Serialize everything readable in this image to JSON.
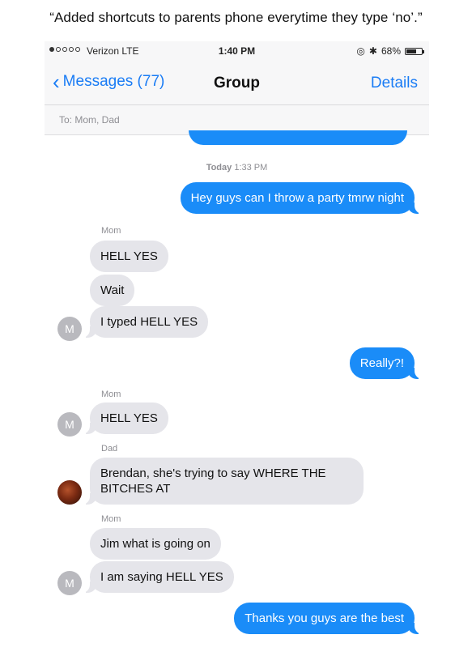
{
  "caption": "“Added shortcuts to parents phone everytime they type ‘no’.”",
  "status_bar": {
    "signal_icon": "signal-dots-icon",
    "carrier": "Verizon  LTE",
    "time": "1:40 PM",
    "battery_percent": "68%",
    "battery_level": 0.68,
    "icons": [
      "location-icon",
      "bluetooth-icon",
      "battery-icon"
    ]
  },
  "nav": {
    "back_label": "Messages (77)",
    "title": "Group",
    "details_label": "Details"
  },
  "to_field": "To: Mom, Dad",
  "timestamp": {
    "day": "Today",
    "time": "1:33 PM"
  },
  "messages": [
    {
      "from": "me",
      "text": "Hey guys can I throw a party tmrw night"
    },
    {
      "sender_label": "Mom"
    },
    {
      "from": "Mom",
      "text": "HELL YES"
    },
    {
      "from": "Mom",
      "text": "Wait"
    },
    {
      "from": "Mom",
      "text": "I typed HELL YES",
      "avatar": "M"
    },
    {
      "from": "me",
      "text": "Really?!"
    },
    {
      "sender_label": "Mom"
    },
    {
      "from": "Mom",
      "text": "HELL YES",
      "avatar": "M"
    },
    {
      "sender_label": "Dad"
    },
    {
      "from": "Dad",
      "line1": "Brendan, she's trying to say WHERE THE",
      "line2": "BITCHES AT"
    },
    {
      "sender_label": "Mom"
    },
    {
      "from": "Mom",
      "text": "Jim what is going on"
    },
    {
      "from": "Mom",
      "text": "I am saying HELL YES",
      "avatar": "M"
    },
    {
      "from": "me",
      "text": "Thanks you guys are the best"
    }
  ],
  "colors": {
    "accent": "#1a7cf5",
    "outgoing_bubble": "#1a8cf8",
    "incoming_bubble": "#e5e5ea",
    "avatar_gray": "#b9b9be"
  }
}
